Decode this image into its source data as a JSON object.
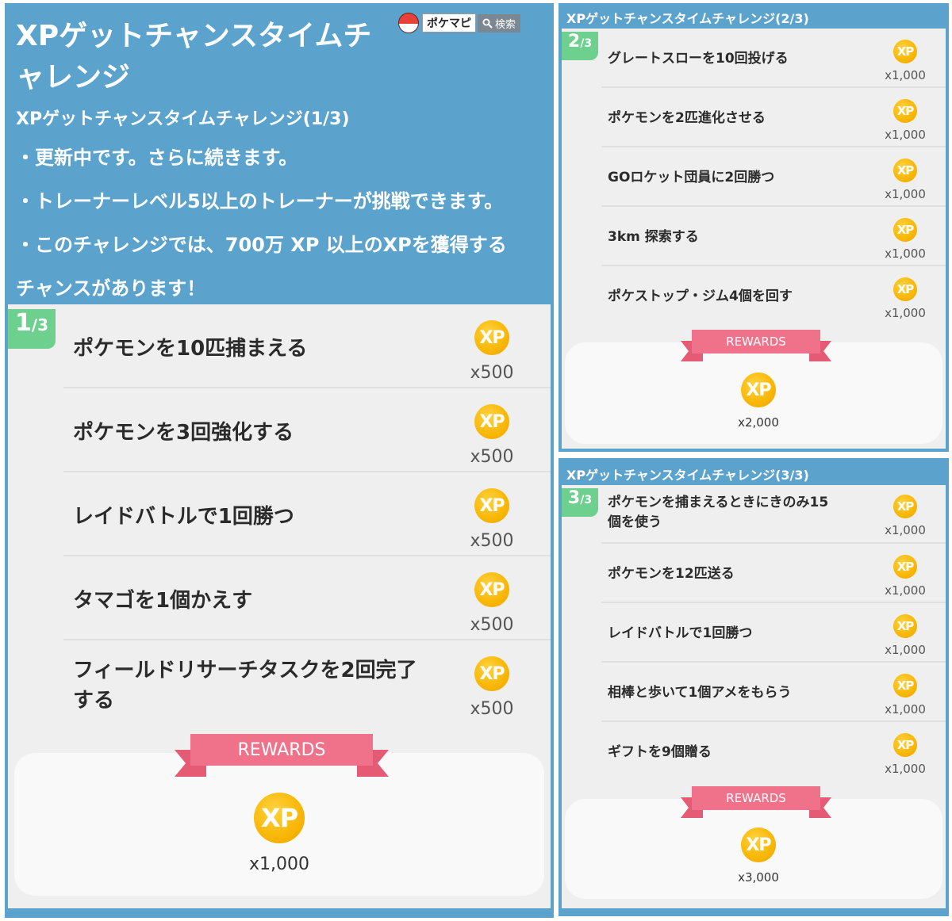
{
  "header": {
    "title_line1": "XPゲットチャンスタイムチ",
    "title_line2": "ャレンジ",
    "site_label": "ポケマピ",
    "search_label": "検索",
    "subtitle": "XPゲットチャンスタイムチャレンジ(1/3)",
    "bullets": [
      "・更新中です。さらに続きます。",
      "・トレーナーレベル5以上のトレーナーが挑戦できます。",
      "・このチャレンジでは、700万 XP 以上のXPを獲得する",
      "チャンスがあります！"
    ]
  },
  "xp_label": "XP",
  "rewards_label": "REWARDS",
  "steps": [
    {
      "section_title": "XPゲットチャンスタイムチャレンジ(1/3)",
      "badge_num": "1",
      "badge_den": "/3",
      "tasks": [
        {
          "line1": "ポケモンを10匹捕まえる",
          "line2": "",
          "amount": "x500"
        },
        {
          "line1": "ポケモンを3回強化する",
          "line2": "",
          "amount": "x500"
        },
        {
          "line1": "レイドバトルで1回勝つ",
          "line2": "",
          "amount": "x500"
        },
        {
          "line1": "タマゴを1個かえす",
          "line2": "",
          "amount": "x500"
        },
        {
          "line1": "フィールドリサーチタスクを2回完了",
          "line2": "する",
          "amount": "x500"
        }
      ],
      "reward_amount": "x1,000"
    },
    {
      "section_title": "XPゲットチャンスタイムチャレンジ(2/3)",
      "badge_num": "2",
      "badge_den": "/3",
      "tasks": [
        {
          "line1": "グレートスローを10回投げる",
          "line2": "",
          "amount": "x1,000"
        },
        {
          "line1": "ポケモンを2匹進化させる",
          "line2": "",
          "amount": "x1,000"
        },
        {
          "line1": "GOロケット団員に2回勝つ",
          "line2": "",
          "amount": "x1,000"
        },
        {
          "line1": "3km 探索する",
          "line2": "",
          "amount": "x1,000"
        },
        {
          "line1": "ポケストップ・ジム4個を回す",
          "line2": "",
          "amount": "x1,000"
        }
      ],
      "reward_amount": "x2,000"
    },
    {
      "section_title": "XPゲットチャンスタイムチャレンジ(3/3)",
      "badge_num": "3",
      "badge_den": "/3",
      "tasks": [
        {
          "line1": "ポケモンを捕まえるときにきのみ15",
          "line2": "個を使う",
          "amount": "x1,000"
        },
        {
          "line1": "ポケモンを12匹送る",
          "line2": "",
          "amount": "x1,000"
        },
        {
          "line1": "レイドバトルで1回勝つ",
          "line2": "",
          "amount": "x1,000"
        },
        {
          "line1": "相棒と歩いて1個アメをもらう",
          "line2": "",
          "amount": "x1,000"
        },
        {
          "line1": "ギフトを9個贈る",
          "line2": "",
          "amount": "x1,000"
        }
      ],
      "reward_amount": "x3,000"
    }
  ],
  "colors": {
    "header_blue": "#5ba3cd",
    "badge_green": "#6ed08e",
    "ribbon_pink": "#f0728a",
    "coin_gold": "#f8b400"
  }
}
